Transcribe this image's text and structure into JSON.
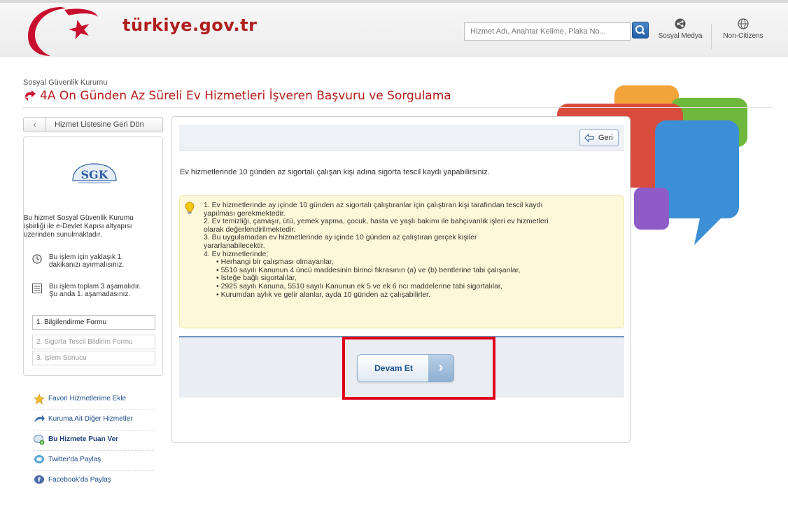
{
  "header": {
    "logo_text": "türkiye.gov.tr",
    "search_placeholder": "Hizmet Adı, Anahtar Kelime, Plaka No...",
    "social_label": "Sosyal Medya",
    "noncitizens_label": "Non-Citizens"
  },
  "page": {
    "breadcrumb": "Sosyal Güvenlik Kurumu",
    "title": "4A On Günden Az Süreli Ev Hizmetleri İşveren Başvuru ve Sorgulama"
  },
  "sidebar": {
    "back_label": "Hizmet Listesine Geri Dön",
    "logo_text": "SGK",
    "desc_line1": "Bu hizmet Sosyal Güvenlik Kurumu",
    "desc_line2": "işbirliği ile e-Devlet Kapısı altyapısı",
    "desc_line3": "üzerinden sunulmaktadır.",
    "time_line1": "Bu işlem için yaklaşık 1",
    "time_line2": "dakikanızı ayırmalısınız.",
    "steps_line1": "Bu işlem toplam 3 aşamalıdır.",
    "steps_line2": "Şu anda 1. aşamadasınız.",
    "steps": [
      "1. Bilgilendirme Formu",
      "2. Sigorta Tescil Bildirim Formu",
      "3. İşlem Sonucu"
    ],
    "links": [
      "Favori Hizmetlerime Ekle",
      "Kuruma Ait Diğer Hizmetler",
      "Bu Hizmete Puan Ver",
      "Twitter'da Paylaş",
      "Facebook'da Paylaş"
    ]
  },
  "main": {
    "geri_label": "Geri",
    "intro": "Ev hizmetlerinde 10 günden az sigortalı çalışan kişi adına sigorta tescil kaydı yapabilirsiniz.",
    "note_lines": [
      "1. Ev hizmetlerinde ay içinde 10 günden az sigortalı çalıştıranlar için çalıştıran kişi tarafından tescil kaydı",
      "yapılması gerekmektedir.",
      "2. Ev temizliği, çamaşır, ütü, yemek yapma, çocuk, hasta ve yaşlı bakımı ile bahçıvanlık işleri ev hizmetleri",
      "olarak değerlendirilmektedir.",
      "3. Bu uygulamadan ev hizmetlerinde ay içinde 10 günden az çalıştıran gerçek kişiler",
      "yararlanabilecektir.",
      "4. Ev hizmetlerinde;"
    ],
    "note_subitems": [
      "• Herhangi bir çalışması olmayanlar,",
      "• 5510 sayılı Kanunun 4 üncü maddesinin birinci fıkrasının (a) ve (b) bentlerine tabi çalışanlar,",
      "• İsteğe bağlı sigortalılar,",
      "• 2925 sayılı Kanuna, 5510 sayılı Kanunun ek 5 ve ek 6 ncı maddelerine tabi sigortalılar,",
      "• Kurumdan aylık ve gelir alanlar, ayda 10 günden az çalışabilirler."
    ],
    "devam_label": "Devam Et"
  }
}
